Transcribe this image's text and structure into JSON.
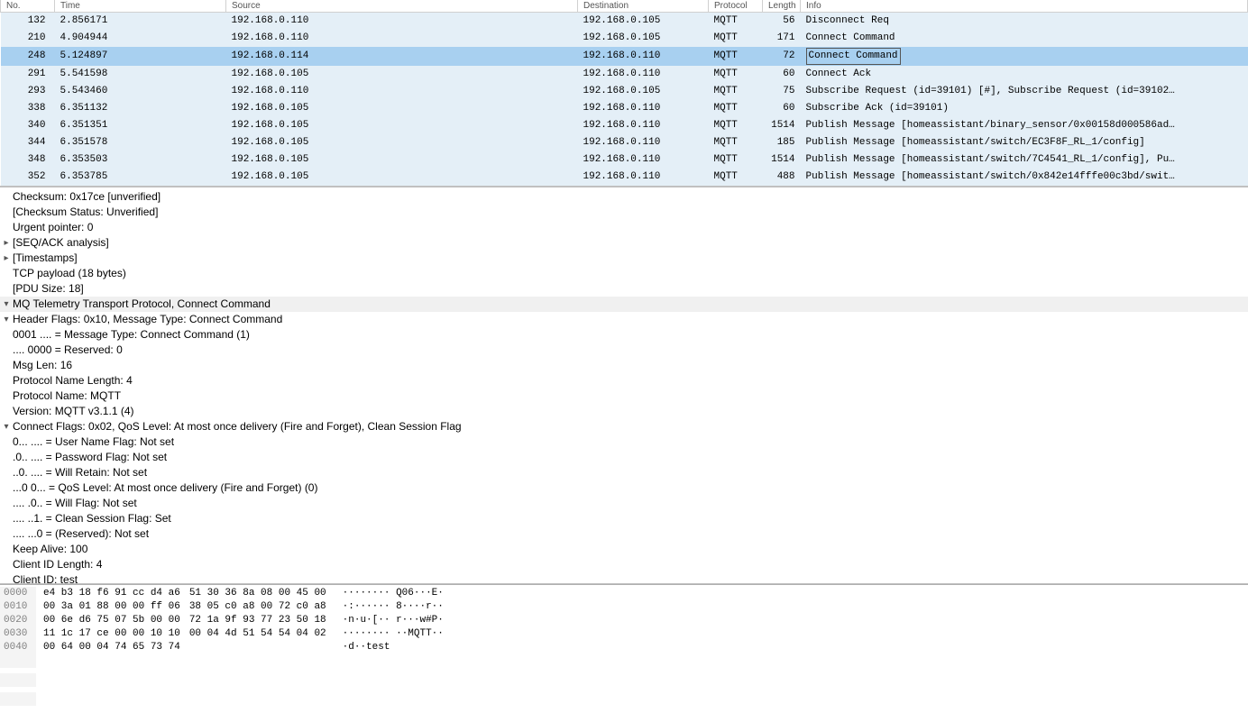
{
  "columns": {
    "no": "No.",
    "time": "Time",
    "source": "Source",
    "destination": "Destination",
    "protocol": "Protocol",
    "length": "Length",
    "info": "Info"
  },
  "packets": [
    {
      "no": "132",
      "time": "2.856171",
      "src": "192.168.0.110",
      "dst": "192.168.0.105",
      "proto": "MQTT",
      "len": "56",
      "info": "Disconnect Req",
      "sel": false
    },
    {
      "no": "210",
      "time": "4.904944",
      "src": "192.168.0.110",
      "dst": "192.168.0.105",
      "proto": "MQTT",
      "len": "171",
      "info": "Connect Command",
      "sel": false
    },
    {
      "no": "248",
      "time": "5.124897",
      "src": "192.168.0.114",
      "dst": "192.168.0.110",
      "proto": "MQTT",
      "len": "72",
      "info": "Connect Command",
      "sel": true
    },
    {
      "no": "291",
      "time": "5.541598",
      "src": "192.168.0.105",
      "dst": "192.168.0.110",
      "proto": "MQTT",
      "len": "60",
      "info": "Connect Ack",
      "sel": false
    },
    {
      "no": "293",
      "time": "5.543460",
      "src": "192.168.0.110",
      "dst": "192.168.0.105",
      "proto": "MQTT",
      "len": "75",
      "info": "Subscribe Request (id=39101) [#], Subscribe Request (id=39102…",
      "sel": false
    },
    {
      "no": "338",
      "time": "6.351132",
      "src": "192.168.0.105",
      "dst": "192.168.0.110",
      "proto": "MQTT",
      "len": "60",
      "info": "Subscribe Ack (id=39101)",
      "sel": false
    },
    {
      "no": "340",
      "time": "6.351351",
      "src": "192.168.0.105",
      "dst": "192.168.0.110",
      "proto": "MQTT",
      "len": "1514",
      "info": "Publish Message [homeassistant/binary_sensor/0x00158d000586ad…",
      "sel": false
    },
    {
      "no": "344",
      "time": "6.351578",
      "src": "192.168.0.105",
      "dst": "192.168.0.110",
      "proto": "MQTT",
      "len": "185",
      "info": "Publish Message [homeassistant/switch/EC3F8F_RL_1/config]",
      "sel": false
    },
    {
      "no": "348",
      "time": "6.353503",
      "src": "192.168.0.105",
      "dst": "192.168.0.110",
      "proto": "MQTT",
      "len": "1514",
      "info": "Publish Message [homeassistant/switch/7C4541_RL_1/config], Pu…",
      "sel": false
    },
    {
      "no": "352",
      "time": "6.353785",
      "src": "192.168.0.105",
      "dst": "192.168.0.110",
      "proto": "MQTT",
      "len": "488",
      "info": "Publish Message [homeassistant/switch/0x842e14fffe00c3bd/swit…",
      "sel": false
    }
  ],
  "tree": [
    {
      "ind": 2,
      "expand": "",
      "text": "Checksum: 0x17ce [unverified]"
    },
    {
      "ind": 2,
      "expand": "",
      "text": "[Checksum Status: Unverified]"
    },
    {
      "ind": 2,
      "expand": "",
      "text": "Urgent pointer: 0"
    },
    {
      "ind": 2,
      "expand": ">",
      "text": "[SEQ/ACK analysis]"
    },
    {
      "ind": 2,
      "expand": ">",
      "text": "[Timestamps]"
    },
    {
      "ind": 2,
      "expand": "",
      "text": "TCP payload (18 bytes)"
    },
    {
      "ind": 2,
      "expand": "",
      "text": "[PDU Size: 18]"
    },
    {
      "ind": 0,
      "expand": "v",
      "text": "MQ Telemetry Transport Protocol, Connect Command",
      "header": true
    },
    {
      "ind": 1,
      "expand": "v",
      "text": "Header Flags: 0x10, Message Type: Connect Command"
    },
    {
      "ind": 3,
      "expand": "",
      "text": "0001 .... = Message Type: Connect Command (1)"
    },
    {
      "ind": 3,
      "expand": "",
      "text": ".... 0000 = Reserved: 0"
    },
    {
      "ind": 2,
      "expand": "",
      "text": "Msg Len: 16"
    },
    {
      "ind": 2,
      "expand": "",
      "text": "Protocol Name Length: 4"
    },
    {
      "ind": 2,
      "expand": "",
      "text": "Protocol Name: MQTT"
    },
    {
      "ind": 2,
      "expand": "",
      "text": "Version: MQTT v3.1.1 (4)"
    },
    {
      "ind": 1,
      "expand": "v",
      "text": "Connect Flags: 0x02, QoS Level: At most once delivery (Fire and Forget), Clean Session Flag"
    },
    {
      "ind": 3,
      "expand": "",
      "text": "0... .... = User Name Flag: Not set"
    },
    {
      "ind": 3,
      "expand": "",
      "text": ".0.. .... = Password Flag: Not set"
    },
    {
      "ind": 3,
      "expand": "",
      "text": "..0. .... = Will Retain: Not set"
    },
    {
      "ind": 3,
      "expand": "",
      "text": "...0 0... = QoS Level: At most once delivery (Fire and Forget) (0)"
    },
    {
      "ind": 3,
      "expand": "",
      "text": ".... .0.. = Will Flag: Not set"
    },
    {
      "ind": 3,
      "expand": "",
      "text": ".... ..1. = Clean Session Flag: Set"
    },
    {
      "ind": 3,
      "expand": "",
      "text": ".... ...0 = (Reserved): Not set"
    },
    {
      "ind": 2,
      "expand": "",
      "text": "Keep Alive: 100"
    },
    {
      "ind": 2,
      "expand": "",
      "text": "Client ID Length: 4"
    },
    {
      "ind": 2,
      "expand": "",
      "text": "Client ID: test"
    }
  ],
  "hex": [
    {
      "off": "0000",
      "b1": "e4 b3 18 f6 91 cc d4 a6",
      "b2": "51 30 36 8a 08 00 45 00",
      "ascii": "········ Q06···E·"
    },
    {
      "off": "0010",
      "b1": "00 3a 01 88 00 00 ff 06",
      "b2": "38 05 c0 a8 00 72 c0 a8",
      "ascii": "·:······ 8····r··"
    },
    {
      "off": "0020",
      "b1": "00 6e d6 75 07 5b 00 00",
      "b2": "72 1a 9f 93 77 23 50 18",
      "ascii": "·n·u·[·· r···w#P·"
    },
    {
      "off": "0030",
      "b1": "11 1c 17 ce 00 00 10 10",
      "b2": "00 04 4d 51 54 54 04 02",
      "ascii": "········ ··MQTT··"
    },
    {
      "off": "0040",
      "b1": "00 64 00 04 74 65 73 74",
      "b2": "",
      "ascii": "·d··test"
    }
  ]
}
